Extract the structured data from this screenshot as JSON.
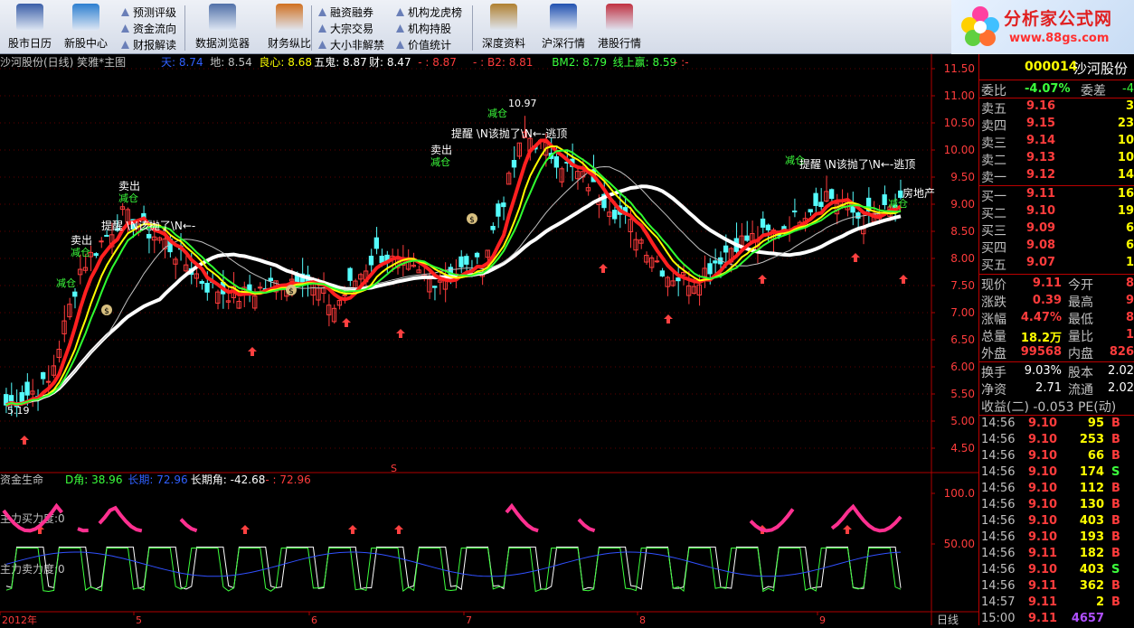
{
  "toolbar": {
    "big": [
      {
        "label": "股市日历",
        "icon": "calendar-icon"
      },
      {
        "label": "新股中心",
        "icon": "chart-check-icon"
      },
      {
        "label": "数据浏览器",
        "icon": "data-grid-icon"
      },
      {
        "label": "财务纵比",
        "icon": "finance-icon"
      },
      {
        "label": "深度资料",
        "icon": "book-icon"
      },
      {
        "label": "沪深行情",
        "icon": "hs-market-icon"
      },
      {
        "label": "港股行情",
        "icon": "hk-market-icon"
      }
    ],
    "small": [
      "预测评级",
      "资金流向",
      "财报解读",
      "融资融券",
      "大宗交易",
      "大小非解禁",
      "机构龙虎榜",
      "机构持股",
      "价值统计"
    ]
  },
  "logo": {
    "title": "分析家公式网",
    "url": "www.88gs.com"
  },
  "main": {
    "title": "沙河股份(日线) 笑雅*主图",
    "ind": [
      {
        "t": "天: 8.74",
        "c": "#3060ff"
      },
      {
        "t": "地: 8.54",
        "c": "#c0c0c0"
      },
      {
        "t": "良心: 8.68",
        "c": "#ffff00"
      },
      {
        "t": "五鬼: 8.87",
        "c": "#ffffff"
      },
      {
        "t": "财: 8.47",
        "c": "#ffffff"
      },
      {
        "t": "- : 8.87",
        "c": "#ff3c3c"
      },
      {
        "t": "- : B2: 8.81",
        "c": "#ff3c3c"
      },
      {
        "t": "BM2: 8.79",
        "c": "#3cff3c"
      },
      {
        "t": "线上赢: 8.59",
        "c": "#3cff3c"
      },
      {
        "t": "- :-",
        "c": "#ff3c3c"
      }
    ],
    "y": [
      "11.50",
      "11.00",
      "10.50",
      "10.00",
      "9.50",
      "9.00",
      "8.50",
      "8.00",
      "7.50",
      "7.00",
      "6.50",
      "6.00",
      "5.50",
      "5.00",
      "4.50"
    ],
    "low": "5.19",
    "high": "10.97",
    "sell": "卖出",
    "cut": "减仓",
    "remind": "提醒 \\N该抛了\\N←-逃顶",
    "remind_short": "提醒 \\N该抛了\\N←-",
    "house": "房地产",
    "dollar": "$",
    "sig": "S"
  },
  "sub": {
    "title": "资金生命",
    "ind": [
      {
        "t": "D角: 38.96",
        "c": "#3cff3c"
      },
      {
        "t": "长期: 72.96",
        "c": "#3060ff"
      },
      {
        "t": "长期角: -42.68",
        "c": "#ffffff"
      },
      {
        "t": "- : 72.96",
        "c": "#ff3c3c"
      }
    ],
    "buy": "主力买力度:0",
    "sellp": "主力卖力度:0",
    "y": [
      "100.0",
      "50.00"
    ],
    "x": [
      {
        "t": "2012年"
      },
      {
        "t": "5"
      },
      {
        "t": "6"
      },
      {
        "t": "7"
      },
      {
        "t": "8"
      },
      {
        "t": "9"
      }
    ],
    "period": "日线"
  },
  "quote": {
    "code": "000014",
    "name": "沙河股份",
    "weibi_l": "委比",
    "weibi": "-4.07%",
    "weicha_l": "委差",
    "weicha": "-4",
    "sells": [
      {
        "l": "卖五",
        "p": "9.16",
        "v": "3"
      },
      {
        "l": "卖四",
        "p": "9.15",
        "v": "23"
      },
      {
        "l": "卖三",
        "p": "9.14",
        "v": "10"
      },
      {
        "l": "卖二",
        "p": "9.13",
        "v": "10"
      },
      {
        "l": "卖一",
        "p": "9.12",
        "v": "14"
      }
    ],
    "buys": [
      {
        "l": "买一",
        "p": "9.11",
        "v": "16"
      },
      {
        "l": "买二",
        "p": "9.10",
        "v": "19"
      },
      {
        "l": "买三",
        "p": "9.09",
        "v": "6"
      },
      {
        "l": "买四",
        "p": "9.08",
        "v": "6"
      },
      {
        "l": "买五",
        "p": "9.07",
        "v": "1"
      }
    ],
    "stats": [
      {
        "l1": "现价",
        "v1": "9.11",
        "c1": "up",
        "l2": "今开",
        "v2": "8"
      },
      {
        "l1": "涨跌",
        "v1": "0.39",
        "c1": "up",
        "l2": "最高",
        "v2": "9"
      },
      {
        "l1": "涨幅",
        "v1": "4.47%",
        "c1": "up",
        "l2": "最低",
        "v2": "8"
      },
      {
        "l1": "总量",
        "v1": "18.2万",
        "c1": "yl",
        "l2": "量比",
        "v2": "1"
      },
      {
        "l1": "外盘",
        "v1": "99568",
        "c1": "up",
        "l2": "内盘",
        "v2": "826"
      }
    ],
    "stats2": [
      {
        "l1": "换手",
        "v1": "9.03%",
        "l2": "股本",
        "v2": "2.02"
      },
      {
        "l1": "净资",
        "v1": "2.71",
        "l2": "流通",
        "v2": "2.02"
      }
    ],
    "eps": "收益(二) -0.053 PE(动)",
    "ticks": [
      [
        "14:56",
        "9.10",
        "95",
        "B"
      ],
      [
        "14:56",
        "9.10",
        "253",
        "B"
      ],
      [
        "14:56",
        "9.10",
        "66",
        "B"
      ],
      [
        "14:56",
        "9.10",
        "174",
        "S"
      ],
      [
        "14:56",
        "9.10",
        "112",
        "B"
      ],
      [
        "14:56",
        "9.10",
        "130",
        "B"
      ],
      [
        "14:56",
        "9.10",
        "403",
        "B"
      ],
      [
        "14:56",
        "9.10",
        "193",
        "B"
      ],
      [
        "14:56",
        "9.11",
        "182",
        "B"
      ],
      [
        "14:56",
        "9.10",
        "403",
        "S"
      ],
      [
        "14:56",
        "9.11",
        "362",
        "B"
      ],
      [
        "14:57",
        "9.11",
        "2",
        "B"
      ],
      [
        "15:00",
        "9.11",
        "4657",
        ""
      ]
    ],
    "colors": {
      "up": "#ff3c3c",
      "down": "#3cff3c",
      "label": "#c0c0c0"
    }
  }
}
